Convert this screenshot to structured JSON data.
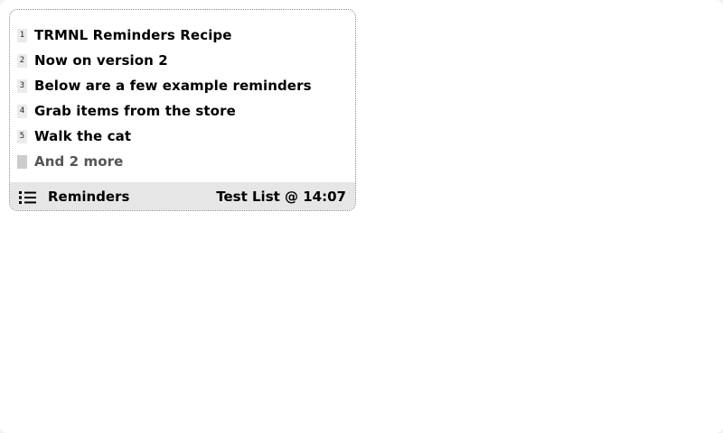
{
  "reminders": {
    "items": [
      {
        "index": "1",
        "label": "TRMNL Reminders Recipe"
      },
      {
        "index": "2",
        "label": "Now on version 2"
      },
      {
        "index": "3",
        "label": "Below are a few example reminders"
      },
      {
        "index": "4",
        "label": "Grab items from the store"
      },
      {
        "index": "5",
        "label": "Walk the cat"
      }
    ],
    "more_label": "And 2 more"
  },
  "footer": {
    "icon": "list-icon",
    "title": "Reminders",
    "meta": "Test List @ 14:07"
  }
}
